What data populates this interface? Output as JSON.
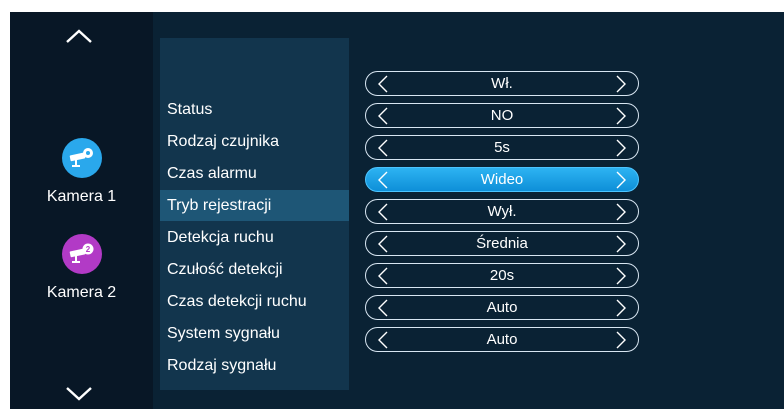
{
  "sidebar": {
    "cameras": [
      {
        "label": "Kamera 1",
        "color": "#2aa8ec",
        "badge": "gear"
      },
      {
        "label": "Kamera 2",
        "color": "#b23ac6",
        "badge": "2"
      }
    ]
  },
  "settings": [
    {
      "label": "Status",
      "value": "Wł."
    },
    {
      "label": "Rodzaj czujnika",
      "value": "NO"
    },
    {
      "label": "Czas alarmu",
      "value": "5s"
    },
    {
      "label": "Tryb rejestracji",
      "value": "Wideo",
      "active": true
    },
    {
      "label": "Detekcja ruchu",
      "value": "Wył."
    },
    {
      "label": "Czułość detekcji",
      "value": "Średnia"
    },
    {
      "label": "Czas detekcji ruchu",
      "value": "20s"
    },
    {
      "label": "System sygnału",
      "value": "Auto"
    },
    {
      "label": "Rodzaj sygnału",
      "value": "Auto"
    }
  ],
  "colors": {
    "background": "#0b1a2a",
    "label_panel": "#12354d",
    "active_row": "#1e5676",
    "active_selector": "#1aa3e8"
  }
}
